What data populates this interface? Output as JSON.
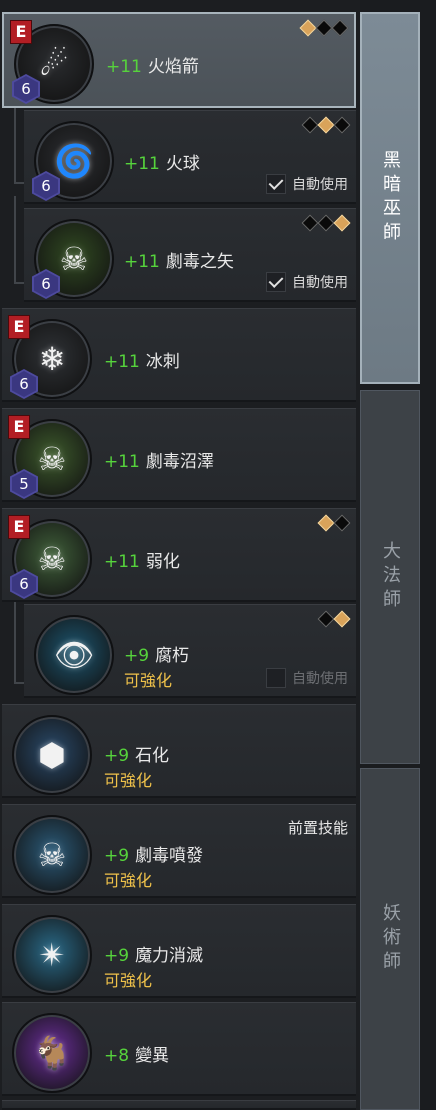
{
  "auto_use_label": "自動使用",
  "upgradable_label": "可強化",
  "skills": [
    {
      "name": "火焰箭",
      "level": "+11",
      "rank": "6",
      "elite": "E",
      "gems": [
        "gold",
        "black",
        "black"
      ],
      "icon": "fire-arrows-icon",
      "glyph": "☄",
      "bg": "#2a2c2f",
      "selected": true
    },
    {
      "name": "火球",
      "level": "+11",
      "rank": "6",
      "gems": [
        "black",
        "gold",
        "black"
      ],
      "auto_use": true,
      "icon": "fireball-swirl-icon",
      "glyph": "🌀",
      "bg": "#2d2f33"
    },
    {
      "name": "劇毒之矢",
      "level": "+11",
      "rank": "6",
      "gems": [
        "black",
        "black",
        "gold"
      ],
      "auto_use": true,
      "icon": "poison-skull-arrow-icon",
      "glyph": "☠",
      "bg": "#314a22"
    },
    {
      "name": "冰刺",
      "level": "+11",
      "rank": "6",
      "elite": "E",
      "icon": "ice-spike-icon",
      "glyph": "❄",
      "bg": "#2f3236"
    },
    {
      "name": "劇毒沼澤",
      "level": "+11",
      "rank": "5",
      "elite": "E",
      "icon": "poison-swamp-skull-icon",
      "glyph": "☠",
      "bg": "#3d5a2c"
    },
    {
      "name": "弱化",
      "level": "+11",
      "rank": "6",
      "elite": "E",
      "gems": [
        "gold",
        "black"
      ],
      "icon": "weaken-skulls-icon",
      "glyph": "☠",
      "bg": "#40603a"
    },
    {
      "name": "腐朽",
      "level": "+9",
      "upgradable": true,
      "gems": [
        "black",
        "gold"
      ],
      "auto_use": false,
      "icon": "decay-eye-icon",
      "glyph": "👁",
      "bg": "#1d5670"
    },
    {
      "name": "石化",
      "level": "+9",
      "upgradable": true,
      "icon": "petrify-rock-icon",
      "glyph": "⬢",
      "bg": "#2a4a6a"
    },
    {
      "name": "劇毒噴發",
      "level": "+9",
      "upgradable": true,
      "prerequisite": "前置技能",
      "icon": "poison-burst-skull-icon",
      "glyph": "☠",
      "bg": "#2b5a78"
    },
    {
      "name": "魔力消滅",
      "level": "+9",
      "upgradable": true,
      "icon": "mana-burn-icon",
      "glyph": "✴",
      "bg": "#2a6a88"
    },
    {
      "name": "變異",
      "level": "+8",
      "icon": "mutation-beast-icon",
      "glyph": "🐐",
      "bg": "#6b2f9a"
    }
  ],
  "tabs": [
    {
      "label": "黑暗巫師",
      "active": true
    },
    {
      "label": "大法師",
      "active": false
    },
    {
      "label": "妖術師",
      "active": false
    }
  ],
  "colors": {
    "level_green": "#56d33c",
    "upgradable_gold": "#f0c24a",
    "elite_red": "#b21e24",
    "rank_purple": "#4d4a9e"
  }
}
